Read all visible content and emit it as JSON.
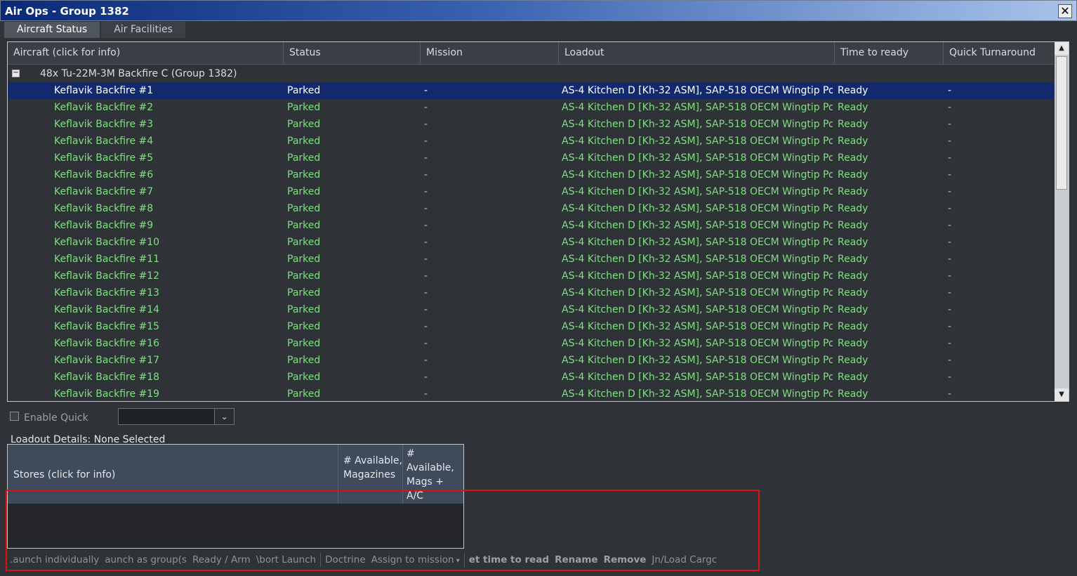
{
  "window": {
    "title": "Air Ops - Group 1382",
    "close_label": "✕"
  },
  "tabs": [
    {
      "label": "Aircraft Status",
      "active": true
    },
    {
      "label": "Air Facilities",
      "active": false
    }
  ],
  "grid": {
    "columns": [
      "Aircraft (click for info)",
      "Status",
      "Mission",
      "Loadout",
      "Time to ready",
      "Quick Turnaround"
    ],
    "group": {
      "toggle": "−",
      "label": "48x Tu-22M-3M Backfire C (Group 1382)"
    },
    "rows": [
      {
        "name": "Keflavik Backfire #1",
        "status": "Parked",
        "mission": "-",
        "loadout": "AS-4 Kitchen D [Kh-32 ASM], SAP-518 OECM Wingtip Po...",
        "ready": "Ready",
        "quick": "-"
      },
      {
        "name": "Keflavik Backfire #2",
        "status": "Parked",
        "mission": "-",
        "loadout": "AS-4 Kitchen D [Kh-32 ASM], SAP-518 OECM Wingtip Po...",
        "ready": "Ready",
        "quick": "-"
      },
      {
        "name": "Keflavik Backfire #3",
        "status": "Parked",
        "mission": "-",
        "loadout": "AS-4 Kitchen D [Kh-32 ASM], SAP-518 OECM Wingtip Po...",
        "ready": "Ready",
        "quick": "-"
      },
      {
        "name": "Keflavik Backfire #4",
        "status": "Parked",
        "mission": "-",
        "loadout": "AS-4 Kitchen D [Kh-32 ASM], SAP-518 OECM Wingtip Po...",
        "ready": "Ready",
        "quick": "-"
      },
      {
        "name": "Keflavik Backfire #5",
        "status": "Parked",
        "mission": "-",
        "loadout": "AS-4 Kitchen D [Kh-32 ASM], SAP-518 OECM Wingtip Po...",
        "ready": "Ready",
        "quick": "-"
      },
      {
        "name": "Keflavik Backfire #6",
        "status": "Parked",
        "mission": "-",
        "loadout": "AS-4 Kitchen D [Kh-32 ASM], SAP-518 OECM Wingtip Po...",
        "ready": "Ready",
        "quick": "-"
      },
      {
        "name": "Keflavik Backfire #7",
        "status": "Parked",
        "mission": "-",
        "loadout": "AS-4 Kitchen D [Kh-32 ASM], SAP-518 OECM Wingtip Po...",
        "ready": "Ready",
        "quick": "-"
      },
      {
        "name": "Keflavik Backfire #8",
        "status": "Parked",
        "mission": "-",
        "loadout": "AS-4 Kitchen D [Kh-32 ASM], SAP-518 OECM Wingtip Po...",
        "ready": "Ready",
        "quick": "-"
      },
      {
        "name": "Keflavik Backfire #9",
        "status": "Parked",
        "mission": "-",
        "loadout": "AS-4 Kitchen D [Kh-32 ASM], SAP-518 OECM Wingtip Po...",
        "ready": "Ready",
        "quick": "-"
      },
      {
        "name": "Keflavik Backfire #10",
        "status": "Parked",
        "mission": "-",
        "loadout": "AS-4 Kitchen D [Kh-32 ASM], SAP-518 OECM Wingtip Po...",
        "ready": "Ready",
        "quick": "-"
      },
      {
        "name": "Keflavik Backfire #11",
        "status": "Parked",
        "mission": "-",
        "loadout": "AS-4 Kitchen D [Kh-32 ASM], SAP-518 OECM Wingtip Po...",
        "ready": "Ready",
        "quick": "-"
      },
      {
        "name": "Keflavik Backfire #12",
        "status": "Parked",
        "mission": "-",
        "loadout": "AS-4 Kitchen D [Kh-32 ASM], SAP-518 OECM Wingtip Po...",
        "ready": "Ready",
        "quick": "-"
      },
      {
        "name": "Keflavik Backfire #13",
        "status": "Parked",
        "mission": "-",
        "loadout": "AS-4 Kitchen D [Kh-32 ASM], SAP-518 OECM Wingtip Po...",
        "ready": "Ready",
        "quick": "-"
      },
      {
        "name": "Keflavik Backfire #14",
        "status": "Parked",
        "mission": "-",
        "loadout": "AS-4 Kitchen D [Kh-32 ASM], SAP-518 OECM Wingtip Po...",
        "ready": "Ready",
        "quick": "-"
      },
      {
        "name": "Keflavik Backfire #15",
        "status": "Parked",
        "mission": "-",
        "loadout": "AS-4 Kitchen D [Kh-32 ASM], SAP-518 OECM Wingtip Po...",
        "ready": "Ready",
        "quick": "-"
      },
      {
        "name": "Keflavik Backfire #16",
        "status": "Parked",
        "mission": "-",
        "loadout": "AS-4 Kitchen D [Kh-32 ASM], SAP-518 OECM Wingtip Po...",
        "ready": "Ready",
        "quick": "-"
      },
      {
        "name": "Keflavik Backfire #17",
        "status": "Parked",
        "mission": "-",
        "loadout": "AS-4 Kitchen D [Kh-32 ASM], SAP-518 OECM Wingtip Po...",
        "ready": "Ready",
        "quick": "-"
      },
      {
        "name": "Keflavik Backfire #18",
        "status": "Parked",
        "mission": "-",
        "loadout": "AS-4 Kitchen D [Kh-32 ASM], SAP-518 OECM Wingtip Po...",
        "ready": "Ready",
        "quick": "-"
      },
      {
        "name": "Keflavik Backfire #19",
        "status": "Parked",
        "mission": "-",
        "loadout": "AS-4 Kitchen D [Kh-32 ASM], SAP-518 OECM Wingtip Po...",
        "ready": "Ready",
        "quick": "-"
      }
    ],
    "selected_index": 0
  },
  "quick": {
    "checkbox_label": "Enable Quick",
    "dropdown_value": ""
  },
  "loadout_details": {
    "title": "Loadout Details: None Selected",
    "col_stores": "Stores (click for info)",
    "col_avail_mag": "# Available, Magazines",
    "col_avail_mags_ac": "# Available, Mags + A/C"
  },
  "actions": [
    {
      "label": ".aunch individually",
      "bold": false
    },
    {
      "label": "aunch as group(s",
      "bold": false
    },
    {
      "label": "Ready / Arm",
      "bold": false
    },
    {
      "label": "\\bort Launch",
      "bold": false
    },
    {
      "label": "|",
      "separator": true
    },
    {
      "label": "Doctrine",
      "bold": false
    },
    {
      "label": "Assign to mission",
      "bold": false,
      "dropdown": true
    },
    {
      "label": "|",
      "separator": true
    },
    {
      "label": "et time to read",
      "bold": true
    },
    {
      "label": "Rename",
      "bold": true
    },
    {
      "label": "Remove",
      "bold": true
    },
    {
      "label": "Jn/Load Cargc",
      "bold": false
    }
  ],
  "colors": {
    "row_text": "#7fe07f",
    "selected_bg": "#12296e",
    "highlight": "#e01010"
  }
}
